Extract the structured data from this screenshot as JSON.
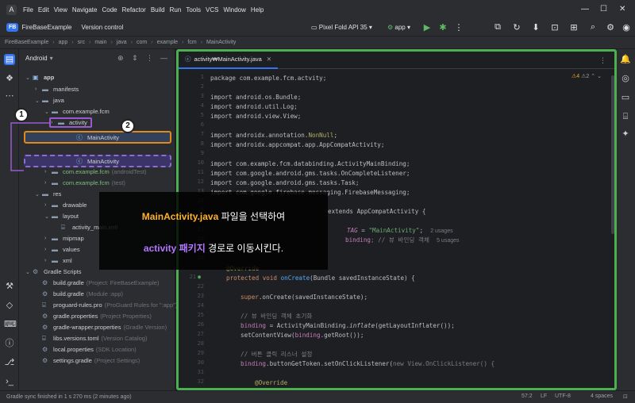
{
  "menubar": {
    "items": [
      "File",
      "Edit",
      "View",
      "Navigate",
      "Code",
      "Refactor",
      "Build",
      "Run",
      "Tools",
      "VCS",
      "Window",
      "Help"
    ]
  },
  "toolbar": {
    "project_badge": "FB",
    "project_name": "FireBaseExample",
    "vcs": "Version control",
    "device": "Pixel Fold API 35",
    "run_config": "app"
  },
  "breadcrumb": [
    "FireBaseExample",
    "app",
    "src",
    "main",
    "java",
    "com",
    "example",
    "fcm",
    "MainActivity"
  ],
  "project_panel": {
    "title": "Android"
  },
  "tree": [
    {
      "label": "app",
      "muted": ""
    },
    {
      "label": "manifests",
      "muted": ""
    },
    {
      "label": "java",
      "muted": ""
    },
    {
      "label": "com.example.fcm",
      "muted": ""
    },
    {
      "label": "activity",
      "muted": ""
    },
    {
      "label": "MainActivity",
      "muted": ""
    },
    {
      "label": "MainActivity",
      "muted": ""
    },
    {
      "label": "com.example.fcm",
      "muted": "(androidTest)"
    },
    {
      "label": "com.example.fcm",
      "muted": "(test)"
    },
    {
      "label": "res",
      "muted": ""
    },
    {
      "label": "drawable",
      "muted": ""
    },
    {
      "label": "layout",
      "muted": ""
    },
    {
      "label": "activity_main.xml",
      "muted": ""
    },
    {
      "label": "mipmap",
      "muted": ""
    },
    {
      "label": "values",
      "muted": ""
    },
    {
      "label": "xml",
      "muted": ""
    },
    {
      "label": "Gradle Scripts",
      "muted": ""
    },
    {
      "label": "build.gradle",
      "muted": "(Project: FireBaseExample)"
    },
    {
      "label": "build.gradle",
      "muted": "(Module :app)"
    },
    {
      "label": "proguard-rules.pro",
      "muted": "(ProGuard Rules for \":app\")"
    },
    {
      "label": "gradle.properties",
      "muted": "(Project Properties)"
    },
    {
      "label": "gradle-wrapper.properties",
      "muted": "(Gradle Version)"
    },
    {
      "label": "libs.versions.toml",
      "muted": "(Version Catalog)"
    },
    {
      "label": "local.properties",
      "muted": "(SDK Location)"
    },
    {
      "label": "settings.gradle",
      "muted": "(Project Settings)"
    }
  ],
  "editor": {
    "tab": "activity₩MainActivity.java",
    "inspections": {
      "warnings": "4",
      "weak": "2"
    },
    "line_numbers": [
      "1",
      "2",
      "3",
      "4",
      "5",
      "6",
      "7",
      "8",
      "9",
      "10",
      "11",
      "12",
      "13",
      "14",
      "15",
      "16",
      "17",
      "18",
      "19",
      "20",
      "21",
      "22",
      "23",
      "24",
      "25",
      "26",
      "27",
      "28",
      "29",
      "30",
      "31",
      "32"
    ],
    "code": {
      "l1": "package com.example.fcm.actvity;",
      "l3": "import android.os.Bundle;",
      "l4": "import android.util.Log;",
      "l5": "import android.view.View;",
      "l7a": "import androidx.annotation.",
      "l7b": "NonNull",
      "l7c": ";",
      "l8": "import androidx.appcompat.app.AppCompatActivity;",
      "l10": "import com.example.fcm.databinding.ActivityMainBinding;",
      "l11": "import com.google.android.gms.tasks.OnCompleteListener;",
      "l12": "import com.google.android.gms.tasks.Task;",
      "l13": "import com.google.firebase.messaging.FirebaseMessaging;",
      "l15": "extends AppCompatActivity {",
      "l17a": "TAG",
      "l17b": " = ",
      "l17c": "\"MainActivity\"",
      "l17d": ";",
      "l17e": "2 usages",
      "l18a": "binding",
      "l18b": "; // 뷰 바인딩 객체",
      "l18c": "5 usages",
      "l20": "@Override",
      "l21a": "protected void ",
      "l21b": "onCreate",
      "l21c": "(Bundle savedInstanceState) {",
      "l23a": "super",
      "l23b": ".onCreate(savedInstanceState);",
      "l25": "// 뷰 바인딩 객체 초기화",
      "l26a": "binding",
      "l26b": " = ActivityMainBinding.",
      "l26c": "inflate",
      "l26d": "(getLayoutInflater());",
      "l27a": "setContentView(",
      "l27b": "binding",
      "l27c": ".getRoot());",
      "l29": "// 버튼 클릭 리스너 설정",
      "l30a": "binding",
      "l30b": ".buttonGetToken.setOnClickListener(",
      "l30c": "new View.OnClickListener() {",
      "l32": "@Override"
    }
  },
  "overlay": {
    "line1_highlight": "MainActivity.java",
    "line1_rest": " 파일을 선택하여",
    "line2_highlight": "activity 패키지",
    "line2_rest": " 경로로 이동시킨다."
  },
  "badges": {
    "one": "1",
    "two": "2"
  },
  "statusbar": {
    "message": "Gradle sync finished in 1 s 270 ms (2 minutes ago)",
    "position": "57:2",
    "line_sep": "LF",
    "encoding": "UTF-8",
    "indent": "4 spaces"
  },
  "colors": {
    "highlight_orange": "#ffb32a",
    "highlight_purple": "#b278ff",
    "editor_border": "#4caf50"
  }
}
